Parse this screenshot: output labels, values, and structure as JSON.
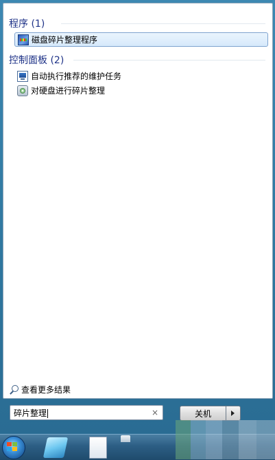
{
  "programs": {
    "header": "程序 (1)",
    "items": [
      {
        "label": "磁盘碎片整理程序",
        "icon": "disk-defragmenter-icon",
        "selected": true
      }
    ]
  },
  "control_panel": {
    "header": "控制面板 (2)",
    "items": [
      {
        "label": "自动执行推荐的维护任务",
        "icon": "maintenance-icon"
      },
      {
        "label": "对硬盘进行碎片整理",
        "icon": "defrag-disk-icon"
      }
    ]
  },
  "see_more": {
    "label": "查看更多结果",
    "icon": "magnifier-icon"
  },
  "search": {
    "value": "碎片整理",
    "clear_symbol": "×"
  },
  "shutdown": {
    "label": "关机"
  },
  "colors": {
    "header_text": "#1e3287",
    "selected_border": "#7da2ce",
    "menu_frame": "#2f779f"
  }
}
